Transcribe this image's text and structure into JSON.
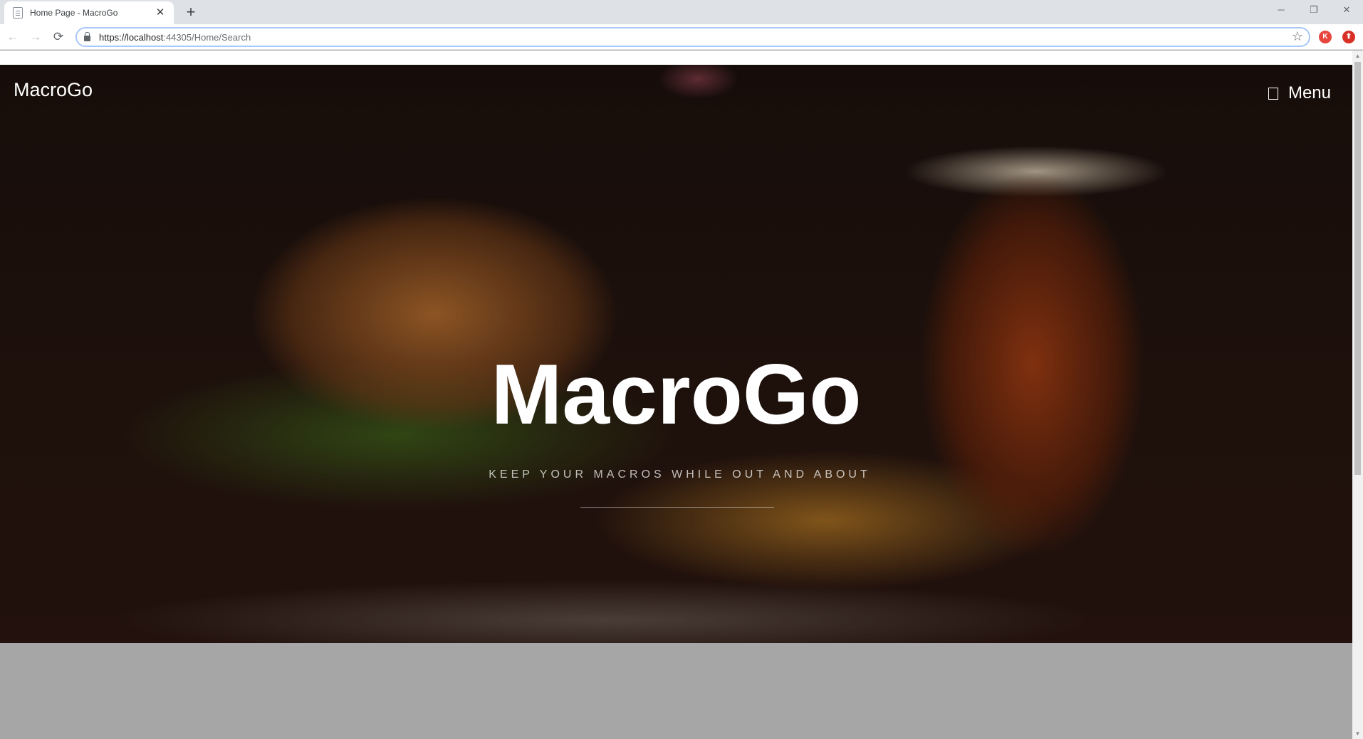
{
  "browser": {
    "tab_title": "Home Page - MacroGo",
    "tab_close": "✕",
    "new_tab": "+",
    "url_host": "https://localhost",
    "url_path": ":44305/Home/Search",
    "back": "←",
    "forward": "→",
    "reload": "⟳",
    "star": "☆",
    "minimize": "─",
    "restore": "❐",
    "close": "✕",
    "profile_initial": "K",
    "extension_glyph": "⬆"
  },
  "site": {
    "brand": "MacroGo",
    "menu_label": "Menu",
    "hero_title": "MacroGo",
    "hero_subtitle": "KEEP YOUR MACROS WHILE OUT AND ABOUT"
  },
  "colors": {
    "profile_badge": "#e8453c",
    "extension_badge": "#d93025",
    "page_background": "#a6a6a6"
  },
  "icons": {
    "hamburger": "bars-icon",
    "lock": "lock-icon",
    "star": "star-icon"
  }
}
